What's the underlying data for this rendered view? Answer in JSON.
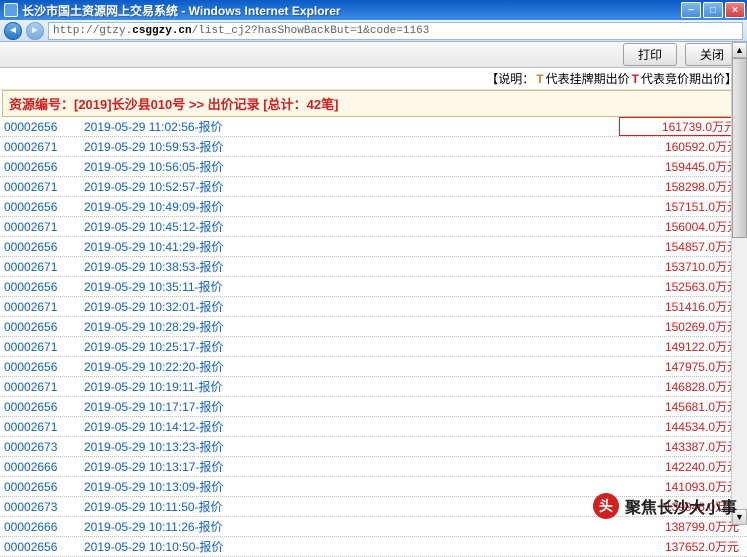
{
  "window": {
    "title": "长沙市国土资源网上交易系统 - Windows Internet Explorer"
  },
  "address": {
    "prefix": "http://gtzy.",
    "domain": "csggzy.cn",
    "path": "/list_cj2?hasShowBackBut=1&code=1163"
  },
  "toolbar": {
    "print": "打印",
    "close": "关闭"
  },
  "legend": {
    "open": "【说明：",
    "t1": "T",
    "label1": "代表挂牌期出价",
    "t2": "T",
    "label2": "代表竞价期出价】"
  },
  "resource_header": "资源编号：[2019]长沙县010号 >> 出价记录 [总计：42笔]",
  "records": [
    {
      "id": "00002656",
      "time": "2019-05-29 11:02:56-报价",
      "price": "161739.0万元"
    },
    {
      "id": "00002671",
      "time": "2019-05-29 10:59:53-报价",
      "price": "160592.0万元"
    },
    {
      "id": "00002656",
      "time": "2019-05-29 10:56:05-报价",
      "price": "159445.0万元"
    },
    {
      "id": "00002671",
      "time": "2019-05-29 10:52:57-报价",
      "price": "158298.0万元"
    },
    {
      "id": "00002656",
      "time": "2019-05-29 10:49:09-报价",
      "price": "157151.0万元"
    },
    {
      "id": "00002671",
      "time": "2019-05-29 10:45:12-报价",
      "price": "156004.0万元"
    },
    {
      "id": "00002656",
      "time": "2019-05-29 10:41:29-报价",
      "price": "154857.0万元"
    },
    {
      "id": "00002671",
      "time": "2019-05-29 10:38:53-报价",
      "price": "153710.0万元"
    },
    {
      "id": "00002656",
      "time": "2019-05-29 10:35:11-报价",
      "price": "152563.0万元"
    },
    {
      "id": "00002671",
      "time": "2019-05-29 10:32:01-报价",
      "price": "151416.0万元"
    },
    {
      "id": "00002656",
      "time": "2019-05-29 10:28:29-报价",
      "price": "150269.0万元"
    },
    {
      "id": "00002671",
      "time": "2019-05-29 10:25:17-报价",
      "price": "149122.0万元"
    },
    {
      "id": "00002656",
      "time": "2019-05-29 10:22:20-报价",
      "price": "147975.0万元"
    },
    {
      "id": "00002671",
      "time": "2019-05-29 10:19:11-报价",
      "price": "146828.0万元"
    },
    {
      "id": "00002656",
      "time": "2019-05-29 10:17:17-报价",
      "price": "145681.0万元"
    },
    {
      "id": "00002671",
      "time": "2019-05-29 10:14:12-报价",
      "price": "144534.0万元"
    },
    {
      "id": "00002673",
      "time": "2019-05-29 10:13:23-报价",
      "price": "143387.0万元"
    },
    {
      "id": "00002666",
      "time": "2019-05-29 10:13:17-报价",
      "price": "142240.0万元"
    },
    {
      "id": "00002656",
      "time": "2019-05-29 10:13:09-报价",
      "price": "141093.0万元"
    },
    {
      "id": "00002673",
      "time": "2019-05-29 10:11:50-报价",
      "price": "139946.0万元"
    },
    {
      "id": "00002666",
      "time": "2019-05-29 10:11:26-报价",
      "price": "138799.0万元"
    },
    {
      "id": "00002656",
      "time": "2019-05-29 10:10:50-报价",
      "price": "137652.0万元"
    }
  ],
  "watermark": {
    "icon": "头",
    "text": "聚焦长沙大小事"
  }
}
